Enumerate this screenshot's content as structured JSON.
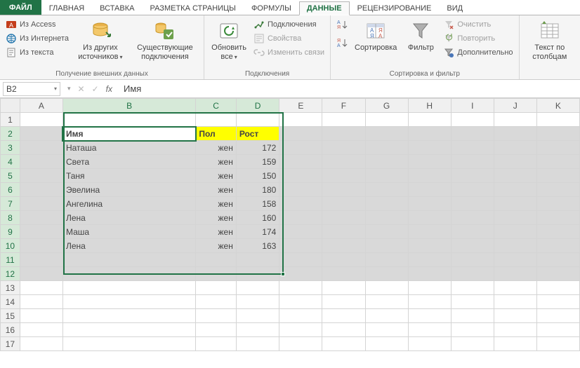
{
  "tabs": {
    "file": "ФАЙЛ",
    "items": [
      "ГЛАВНАЯ",
      "ВСТАВКА",
      "РАЗМЕТКА СТРАНИЦЫ",
      "ФОРМУЛЫ",
      "ДАННЫЕ",
      "РЕЦЕНЗИРОВАНИЕ",
      "ВИД"
    ],
    "active_index": 4
  },
  "ribbon": {
    "group_data_get": {
      "from_access": "Из Access",
      "from_web": "Из Интернета",
      "from_text": "Из текста",
      "from_other": "Из других\nисточников",
      "existing": "Существующие\nподключения",
      "label": "Получение внешних данных"
    },
    "group_connections": {
      "refresh": "Обновить\nвсе",
      "connections": "Подключения",
      "properties": "Свойства",
      "edit_links": "Изменить связи",
      "label": "Подключения"
    },
    "group_sort": {
      "sort": "Сортировка",
      "filter": "Фильтр",
      "clear": "Очистить",
      "reapply": "Повторить",
      "advanced": "Дополнительно",
      "label": "Сортировка и фильтр"
    },
    "group_tools": {
      "text_to_columns": "Текст по\nстолбцам"
    }
  },
  "formula_bar": {
    "name_ref": "B2",
    "value": "Имя"
  },
  "grid": {
    "columns": [
      "A",
      "B",
      "C",
      "D",
      "E",
      "F",
      "G",
      "H",
      "I",
      "J",
      "K"
    ],
    "selected_cols": [
      "B",
      "C",
      "D"
    ],
    "selected_rows": [
      2,
      3,
      4,
      5,
      6,
      7,
      8,
      9,
      10,
      11,
      12
    ],
    "active_cell": "B2",
    "headers": {
      "B": "Имя",
      "C": "Пол",
      "D": "Рост"
    },
    "rows": [
      {
        "B": "Наташа",
        "C": "жен",
        "D": 172
      },
      {
        "B": "Света",
        "C": "жен",
        "D": 159
      },
      {
        "B": "Таня",
        "C": "жен",
        "D": 150
      },
      {
        "B": "Эвелина",
        "C": "жен",
        "D": 180
      },
      {
        "B": "Ангелина",
        "C": "жен",
        "D": 158
      },
      {
        "B": "Лена",
        "C": "жен",
        "D": 160
      },
      {
        "B": "Маша",
        "C": "жен",
        "D": 174
      },
      {
        "B": "Лена",
        "C": "жен",
        "D": 163
      }
    ],
    "visible_row_count": 17
  }
}
